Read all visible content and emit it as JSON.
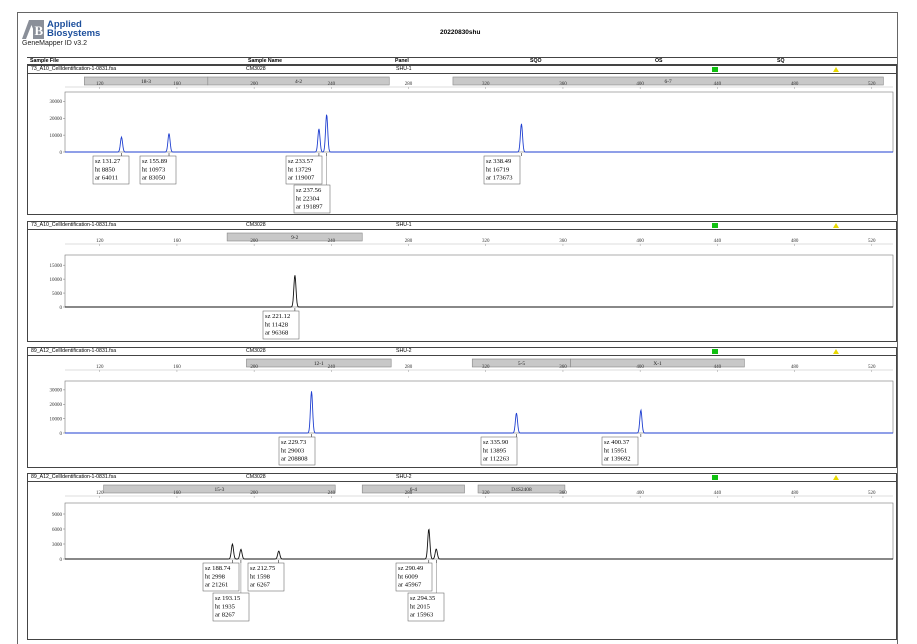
{
  "header": {
    "logo_line1": "Applied",
    "logo_line2": "Biosystems",
    "software": "GeneMapper ID v3.2",
    "run_title": "20220830shu",
    "columns": {
      "sample_file": "Sample File",
      "sample_name": "Sample Name",
      "panel": "Panel",
      "sqo": "SQO",
      "os": "OS",
      "sq": "SQ"
    }
  },
  "colors": {
    "trace_blue": "#1f3fd0",
    "trace_black": "#111111",
    "bin_gray": "#c8c8c8",
    "sq_green": "#10c010",
    "sqo_yellow": "#e8d800"
  },
  "chart_data": [
    {
      "type": "line",
      "sample_file": "73_A10_CellIdentification-1-0831.fsa",
      "sample_name": "CM3028",
      "panel": "SHU-1",
      "trace_color": "blue",
      "x_ticks": [
        120,
        160,
        200,
        240,
        280,
        320,
        360,
        400,
        440,
        480,
        520
      ],
      "xlim": [
        102,
        531
      ],
      "ylim": [
        0,
        32000
      ],
      "y_ticks": [
        0,
        10000,
        20000,
        30000
      ],
      "bins": [
        {
          "label": "18-3",
          "from": 112,
          "to": 176
        },
        {
          "label": "4-2",
          "from": 176,
          "to": 270
        },
        {
          "label": "6-7",
          "from": 303,
          "to": 526
        }
      ],
      "peaks": [
        {
          "sz": 131.27,
          "ht": 8850,
          "ar": 64011
        },
        {
          "sz": 155.89,
          "ht": 10973,
          "ar": 83050
        },
        {
          "sz": 233.57,
          "ht": 13729,
          "ar": 119007
        },
        {
          "sz": 237.56,
          "ht": 22304,
          "ar": 191897
        },
        {
          "sz": 338.49,
          "ht": 16719,
          "ar": 173673
        }
      ],
      "labels": [
        {
          "lines": [
            "sz 131.27",
            "ht 8850",
            "ar 64011"
          ]
        },
        {
          "lines": [
            "sz 155.89",
            "ht 10973",
            "ar 83050"
          ]
        },
        {
          "lines": [
            "sz 233.57",
            "ht 13729",
            "ar 119007"
          ]
        },
        {
          "lines": [
            "sz 237.56",
            "ht 22304",
            "ar 191897"
          ]
        },
        {
          "lines": [
            "sz 338.49",
            "ht 16719",
            "ar 173673"
          ]
        }
      ]
    },
    {
      "type": "line",
      "sample_file": "73_A10_CellIdentification-1-0831.fsa",
      "sample_name": "CM3028",
      "panel": "SHU-1",
      "trace_color": "black",
      "x_ticks": [
        120,
        160,
        200,
        240,
        280,
        320,
        360,
        400,
        440,
        480,
        520
      ],
      "xlim": [
        102,
        531
      ],
      "ylim": [
        0,
        16500
      ],
      "y_ticks": [
        0,
        5000,
        10000,
        15000
      ],
      "bins": [
        {
          "label": "9-2",
          "from": 186,
          "to": 256
        }
      ],
      "peaks": [
        {
          "sz": 221.12,
          "ht": 11428,
          "ar": 96368
        }
      ],
      "labels": [
        {
          "lines": [
            "sz 221.12",
            "ht 11428",
            "ar 96368"
          ]
        }
      ]
    },
    {
      "type": "line",
      "sample_file": "89_A12_CellIdentification-1-0831.fsa",
      "sample_name": "CM3028",
      "panel": "SHU-2",
      "trace_color": "blue",
      "x_ticks": [
        120,
        160,
        200,
        240,
        280,
        320,
        360,
        400,
        440,
        480,
        520
      ],
      "xlim": [
        102,
        531
      ],
      "ylim": [
        0,
        32000
      ],
      "y_ticks": [
        0,
        10000,
        20000,
        30000
      ],
      "bins": [
        {
          "label": "12-1",
          "from": 196,
          "to": 271
        },
        {
          "label": "5-5",
          "from": 313,
          "to": 364
        },
        {
          "label": "X-1",
          "from": 364,
          "to": 454
        }
      ],
      "peaks": [
        {
          "sz": 229.73,
          "ht": 29003,
          "ar": 208808
        },
        {
          "sz": 335.9,
          "ht": 13895,
          "ar": 112263
        },
        {
          "sz": 400.37,
          "ht": 15951,
          "ar": 139692
        }
      ],
      "labels": [
        {
          "lines": [
            "sz 229.73",
            "ht 29003",
            "ar 208808"
          ]
        },
        {
          "lines": [
            "sz 335.90",
            "ht 13895",
            "ar 112263"
          ]
        },
        {
          "lines": [
            "sz 400.37",
            "ht 15951",
            "ar 139692"
          ]
        }
      ]
    },
    {
      "type": "line",
      "sample_file": "89_A12_CellIdentification-1-0831.fsa",
      "sample_name": "CM3028",
      "panel": "SHU-2",
      "trace_color": "black",
      "x_ticks": [
        120,
        160,
        200,
        240,
        280,
        320,
        360,
        400,
        440,
        480,
        520
      ],
      "xlim": [
        102,
        531
      ],
      "ylim": [
        0,
        10000
      ],
      "y_ticks": [
        0,
        3000,
        6000,
        9000
      ],
      "bins": [
        {
          "label": "15-3",
          "from": 122,
          "to": 242
        },
        {
          "label": "6-4",
          "from": 256,
          "to": 309
        },
        {
          "label": "D4S2408",
          "from": 316,
          "to": 361
        }
      ],
      "peaks": [
        {
          "sz": 188.74,
          "ht": 2998,
          "ar": 21261
        },
        {
          "sz": 193.15,
          "ht": 1935,
          "ar": 8267
        },
        {
          "sz": 212.75,
          "ht": 1598,
          "ar": 6267
        },
        {
          "sz": 290.49,
          "ht": 6009,
          "ar": 45967
        },
        {
          "sz": 294.35,
          "ht": 2015,
          "ar": 15963
        }
      ],
      "labels": [
        {
          "lines": [
            "sz 188.74",
            "ht 2998",
            "ar 21261"
          ]
        },
        {
          "lines": [
            "sz 193.15",
            "ht 1935",
            "ar 8267"
          ]
        },
        {
          "lines": [
            "sz 212.75",
            "ht 1598",
            "ar 6267"
          ]
        },
        {
          "lines": [
            "sz 290.49",
            "ht 6009",
            "ar 45967"
          ]
        },
        {
          "lines": [
            "sz 294.35",
            "ht 2015",
            "ar 15963"
          ]
        }
      ]
    }
  ]
}
